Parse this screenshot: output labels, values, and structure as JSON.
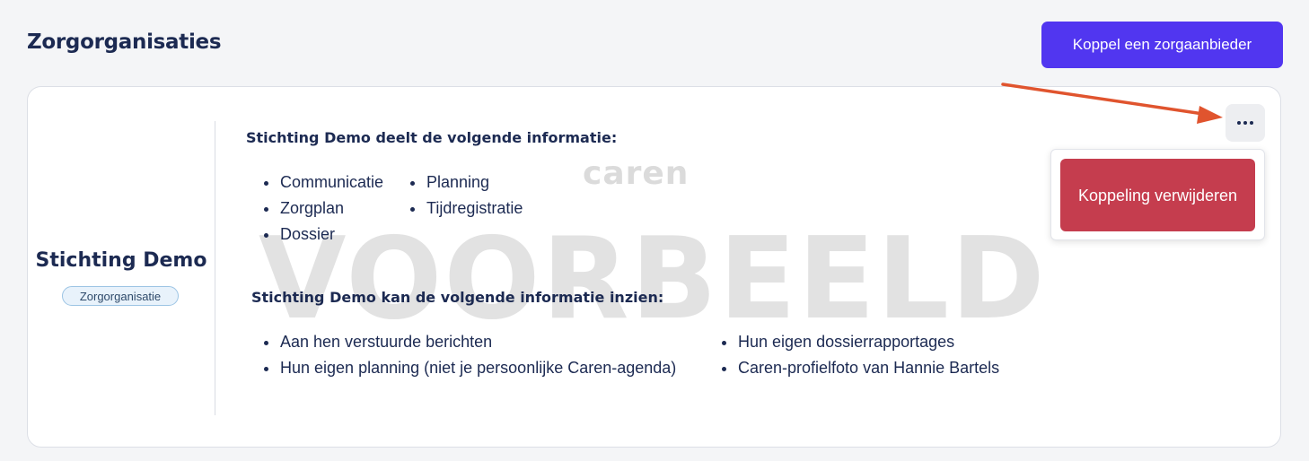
{
  "header": {
    "title": "Zorgorganisaties",
    "connect_button": "Koppel een zorgaanbieder"
  },
  "organization": {
    "name": "Stichting Demo",
    "type_badge": "Zorgorganisatie",
    "shares_title": "Stichting Demo deelt de volgende informatie:",
    "shares_col1": [
      "Communicatie",
      "Zorgplan",
      "Dossier"
    ],
    "shares_col2": [
      "Planning",
      "Tijdregistratie"
    ],
    "views_title": "Stichting Demo kan de volgende informatie inzien:",
    "views_col1": [
      "Aan hen verstuurde berichten",
      "Hun eigen planning (niet je persoonlijke Caren-agenda)"
    ],
    "views_col2": [
      "Hun eigen dossierrapportages",
      "Caren-profielfoto van Hannie Bartels"
    ]
  },
  "menu": {
    "more_icon": "ellipsis-icon",
    "remove_label": "Koppeling verwijderen"
  },
  "watermark": {
    "logo": "caren",
    "stamp": "VOORBEELD"
  },
  "colors": {
    "primary": "#5136f0",
    "danger": "#c53d4e",
    "navy": "#1c2a52",
    "annotation_arrow": "#e0542e"
  }
}
